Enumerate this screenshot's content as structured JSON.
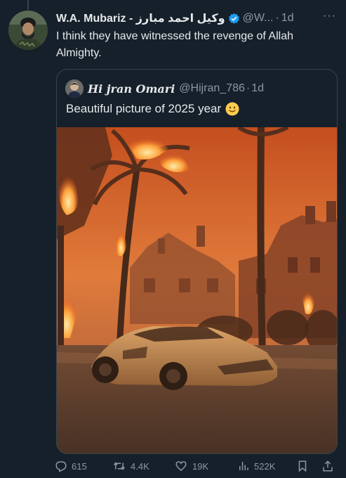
{
  "author": {
    "name": "W.A. Mubariz - وکیل احمد مبارز",
    "handle": "@W...",
    "time": "1d",
    "more_label": "···"
  },
  "tweet": {
    "text": "I think they have witnessed the revenge of Allah Almighty."
  },
  "quote": {
    "name": "Hi jran Omari",
    "handle": "@Hijran_786",
    "time": "1d",
    "text": "Beautiful picture of 2025 year"
  },
  "actions": {
    "replies": "615",
    "reposts": "4.4K",
    "likes": "19K",
    "views": "522K"
  },
  "icons": [
    "verified-icon",
    "more-icon",
    "reply-icon",
    "repost-icon",
    "like-icon",
    "views-icon",
    "bookmark-icon",
    "share-icon",
    "smile-emoji"
  ],
  "colors": {
    "background": "#15202b",
    "text": "#e7e9ea",
    "muted": "#8b98a5",
    "border": "#38444d",
    "verified": "#1d9bf0"
  }
}
